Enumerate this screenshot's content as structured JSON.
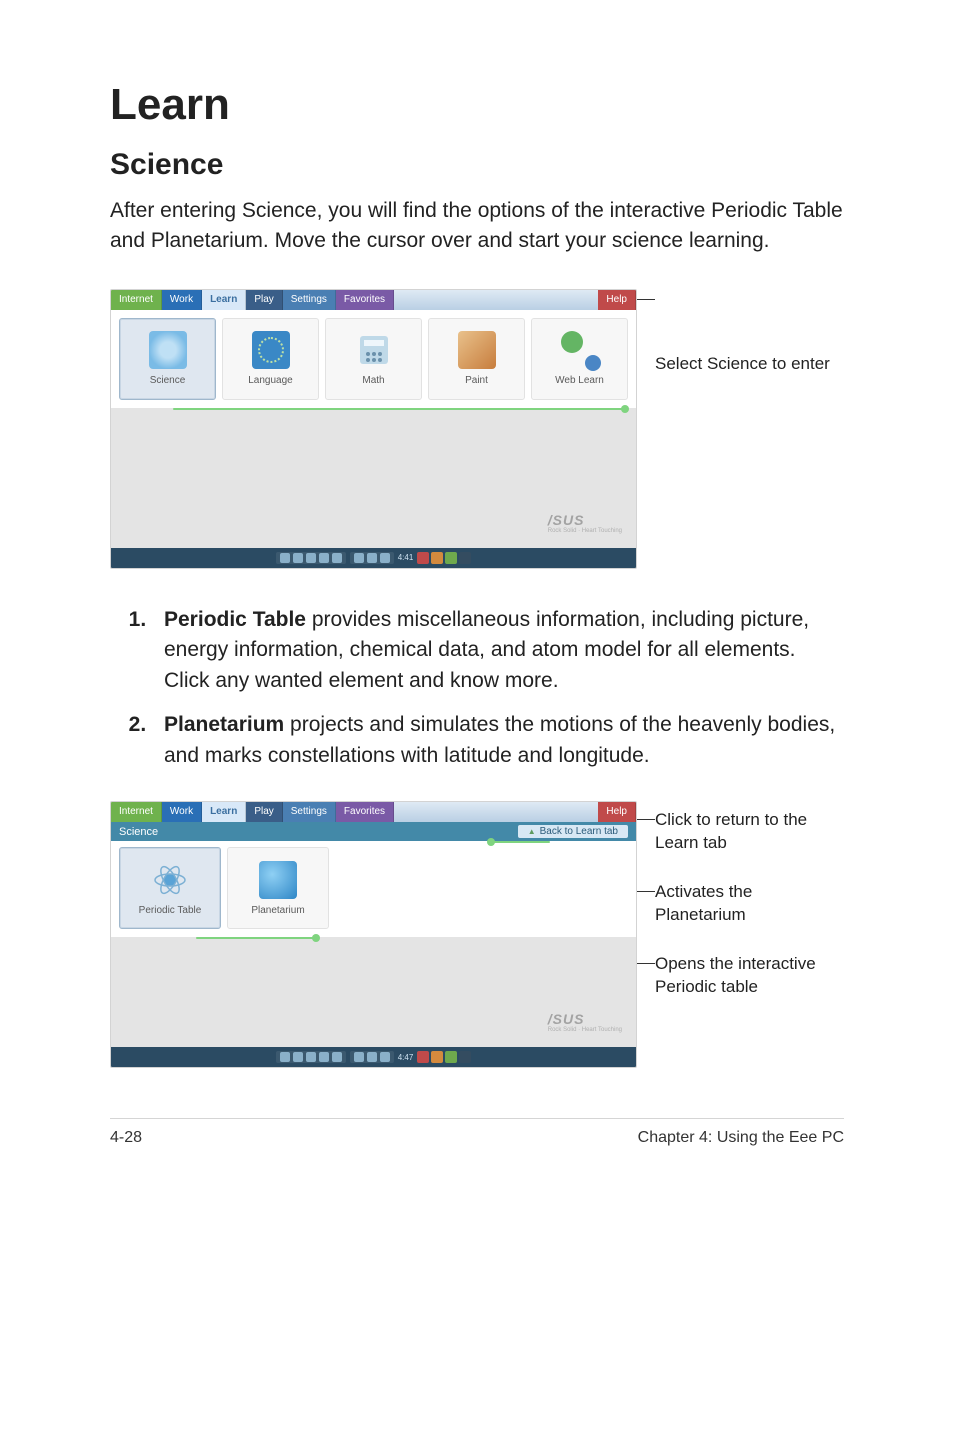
{
  "heading": "Learn",
  "subheading": "Science",
  "intro": "After entering Science, you will find the options of the interactive Periodic Table and Planetarium. Move the cursor over and start your science learning.",
  "tabs": {
    "internet": "Internet",
    "work": "Work",
    "learn": "Learn",
    "play": "Play",
    "settings": "Settings",
    "favorites": "Favorites",
    "help": "Help"
  },
  "launchers": {
    "science": "Science",
    "language": "Language",
    "math": "Math",
    "paint": "Paint",
    "weblearn": "Web Learn",
    "periodic": "Periodic Table",
    "planetarium": "Planetarium"
  },
  "brand": "/SUS",
  "brand_sub": "Rock Solid · Heart Touching",
  "crumb_label": "Science",
  "back_label": "Back to Learn tab",
  "clock1": "4:41",
  "clock2": "4:47",
  "caption_shot1": "Select Science to enter",
  "caption_back": "Click to return to the Learn tab",
  "caption_planet": "Activates the Planetarium",
  "caption_periodic": "Opens the interactive Periodic table",
  "list": {
    "item1_term": "Periodic Table",
    "item1_rest": " provides miscellaneous information, including picture, energy information, chemical data, and atom model for all elements. Click any wanted element and know more.",
    "item2_term": "Planetarium",
    "item2_rest": " projects and simulates the motions of the heavenly bodies, and marks constellations with latitude and longitude."
  },
  "footer_left": "4-28",
  "footer_right": "Chapter 4: Using the Eee PC"
}
